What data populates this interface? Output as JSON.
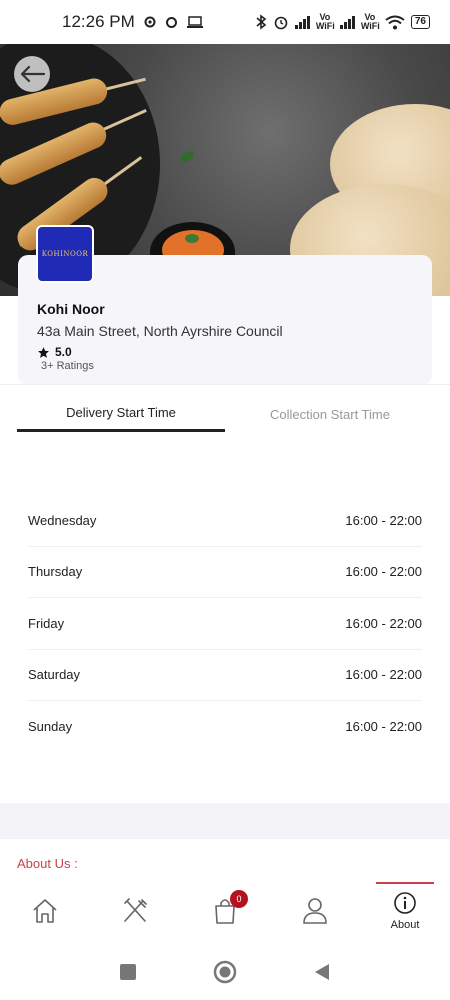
{
  "status_bar": {
    "time": "12:26 PM",
    "vowifi_1": "Vo WiFi",
    "vowifi_2": "Vo WiFi",
    "battery": "76"
  },
  "restaurant": {
    "logo_text": "KOHINOOR",
    "name": "Kohi Noor",
    "address": "43a Main Street, North Ayrshire Council",
    "rating": "5.0",
    "ratings_count": "3+ Ratings"
  },
  "tabs": [
    {
      "label": "Delivery Start Time",
      "active": true
    },
    {
      "label": "Collection Start Time",
      "active": false
    }
  ],
  "hours": [
    {
      "day": "Wednesday",
      "time": "16:00 - 22:00"
    },
    {
      "day": "Thursday",
      "time": "16:00 - 22:00"
    },
    {
      "day": "Friday",
      "time": "16:00 - 22:00"
    },
    {
      "day": "Saturday",
      "time": "16:00 - 22:00"
    },
    {
      "day": "Sunday",
      "time": "16:00 - 22:00"
    }
  ],
  "about": {
    "heading": "About Us :"
  },
  "bottom_nav": {
    "items": [
      {
        "icon": "home-icon"
      },
      {
        "icon": "menu-icon"
      },
      {
        "icon": "cart-icon",
        "badge": "0"
      },
      {
        "icon": "profile-icon"
      },
      {
        "icon": "info-icon",
        "label": "About",
        "active": true
      }
    ]
  },
  "colors": {
    "accent": "#c8414f",
    "badge": "#b3121f",
    "logo_bg": "#1f2bb5"
  }
}
